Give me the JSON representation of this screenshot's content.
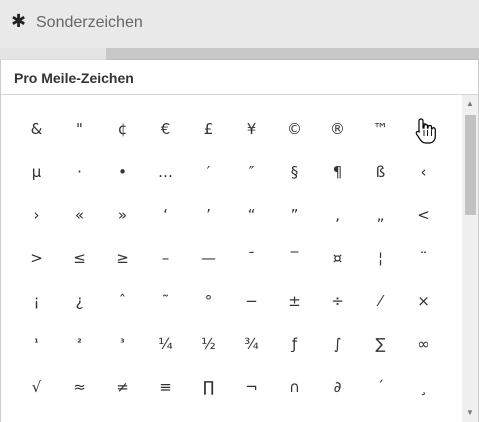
{
  "topbar": {
    "icon": "asterisk-icon",
    "title": "Sonderzeichen"
  },
  "panel": {
    "heading": "Pro Meile-Zeichen"
  },
  "characters": [
    [
      "&",
      "\"",
      "¢",
      "€",
      "£",
      "¥",
      "©",
      "®",
      "™",
      "§"
    ],
    [
      "µ",
      "·",
      "•",
      "…",
      "′",
      "″",
      "§",
      "¶",
      "ß",
      "‹"
    ],
    [
      "›",
      "«",
      "»",
      "‘",
      "’",
      "“",
      "”",
      "‚",
      "„",
      "<"
    ],
    [
      ">",
      "≤",
      "≥",
      "–",
      "—",
      "¯",
      "‾",
      "¤",
      "¦",
      "¨"
    ],
    [
      "¡",
      "¿",
      "ˆ",
      "˜",
      "°",
      "−",
      "±",
      "÷",
      "⁄",
      "×"
    ],
    [
      "¹",
      "²",
      "³",
      "¼",
      "½",
      "¾",
      "ƒ",
      "∫",
      "∑",
      "∞"
    ],
    [
      "√",
      "≈",
      "≠",
      "≡",
      "∏",
      "¬",
      "∩",
      "∂",
      "´",
      "¸"
    ]
  ],
  "scrollbar": {
    "up_icon": "▲",
    "down_icon": "▼"
  }
}
